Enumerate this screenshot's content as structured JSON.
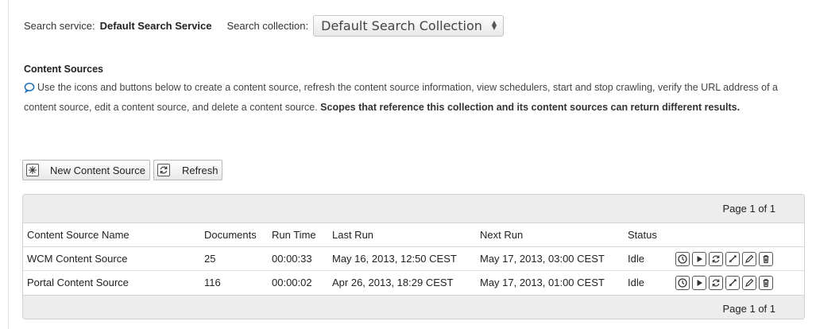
{
  "service": {
    "label": "Search service:",
    "value": "Default Search Service",
    "collection_label": "Search collection:",
    "collection_value": "Default Search Collection"
  },
  "content": {
    "title": "Content Sources",
    "description": "Use the icons and buttons below to create a content source, refresh the content source information, view schedulers, start and stop crawling, verify the URL address of a content source, edit a content source, and delete a content source.",
    "description_bold": "Scopes that reference this collection and its content sources can return different results."
  },
  "toolbar": {
    "new_label": "New Content Source",
    "refresh_label": "Refresh"
  },
  "table": {
    "pager_top": "Page 1 of 1",
    "pager_bottom": "Page 1 of 1",
    "columns": [
      "Content Source Name",
      "Documents",
      "Run Time",
      "Last Run",
      "Next Run",
      "Status",
      ""
    ],
    "rows": [
      {
        "name": "WCM Content Source",
        "documents": "25",
        "run_time": "00:00:33",
        "last_run": "May 16, 2013, 12:50 CEST",
        "next_run": "May 17, 2013, 03:00 CEST",
        "status": "Idle"
      },
      {
        "name": "Portal Content Source",
        "documents": "116",
        "run_time": "00:00:02",
        "last_run": "Apr 26, 2013, 18:29 CEST",
        "next_run": "May 17, 2013, 01:00 CEST",
        "status": "Idle"
      }
    ],
    "row_actions": [
      "scheduler-icon",
      "start-crawl-icon",
      "refresh-icon",
      "verify-url-icon",
      "edit-icon",
      "delete-icon"
    ]
  },
  "colors": {
    "pager_bg": "#ededed",
    "info_icon": "#1f6fb5"
  }
}
